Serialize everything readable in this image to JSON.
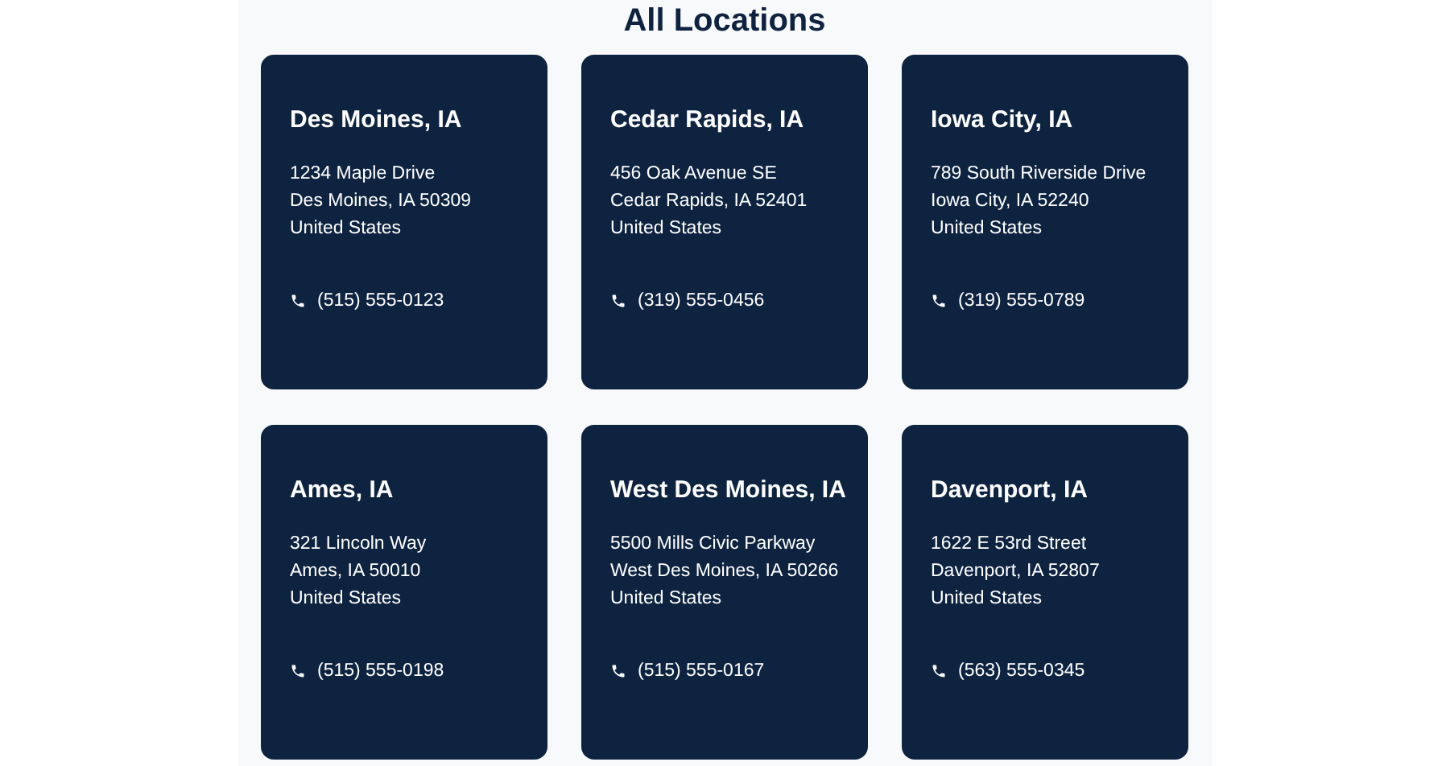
{
  "title": "All Locations",
  "locations": [
    {
      "name": "Des Moines, IA",
      "address": [
        "1234 Maple Drive",
        "Des Moines, IA 50309",
        "United States"
      ],
      "phone": "(515) 555-0123"
    },
    {
      "name": "Cedar Rapids, IA",
      "address": [
        "456 Oak Avenue SE",
        "Cedar Rapids, IA 52401",
        "United States"
      ],
      "phone": "(319) 555-0456"
    },
    {
      "name": "Iowa City, IA",
      "address": [
        "789 South Riverside Drive",
        "Iowa City, IA 52240",
        "United States"
      ],
      "phone": "(319) 555-0789"
    },
    {
      "name": "Ames, IA",
      "address": [
        "321 Lincoln Way",
        "Ames, IA 50010",
        "United States"
      ],
      "phone": "(515) 555-0198"
    },
    {
      "name": "West Des Moines, IA",
      "address": [
        "5500 Mills Civic Parkway",
        "West Des Moines, IA 50266",
        "United States"
      ],
      "phone": "(515) 555-0167"
    },
    {
      "name": "Davenport, IA",
      "address": [
        "1622 E 53rd Street",
        "Davenport, IA 52807",
        "United States"
      ],
      "phone": "(563) 555-0345"
    }
  ]
}
